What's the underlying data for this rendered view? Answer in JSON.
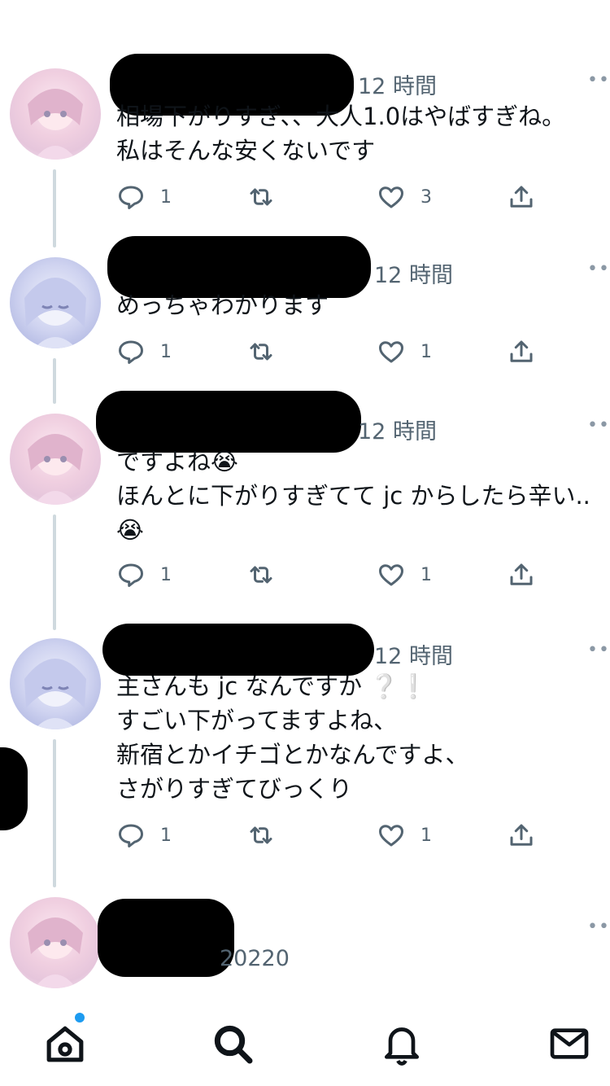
{
  "tweets": [
    {
      "time": "12 時間",
      "text": "相場下がりすぎ、、大人1.0はやばすぎね。\n私はそんな安くないです",
      "replies": "1",
      "likes": "3"
    },
    {
      "time": "12 時間",
      "text": "めっちゃわかります",
      "replies": "1",
      "likes": "1"
    },
    {
      "time": "12 時間",
      "text": "ですよね😭\nほんとに下がりすぎてて jc からしたら辛い..\n😭",
      "replies": "1",
      "likes": "1"
    },
    {
      "time": "12 時間",
      "text": "主さんも jc なんですか ❔❕\nすごい下がってますよね、\n新宿とかイチゴとかなんですよ、\nさがりすぎてびっくり",
      "replies": "1",
      "likes": "1"
    },
    {
      "partial_text": "20220"
    }
  ],
  "more_glyph": "••",
  "tabbar": {
    "items": [
      "home-tab",
      "search-tab",
      "notifications-tab",
      "messages-tab"
    ]
  },
  "colors": {
    "accent": "#1d9bf0",
    "secondary_text": "#536471",
    "thread_line": "#cfd9de"
  }
}
